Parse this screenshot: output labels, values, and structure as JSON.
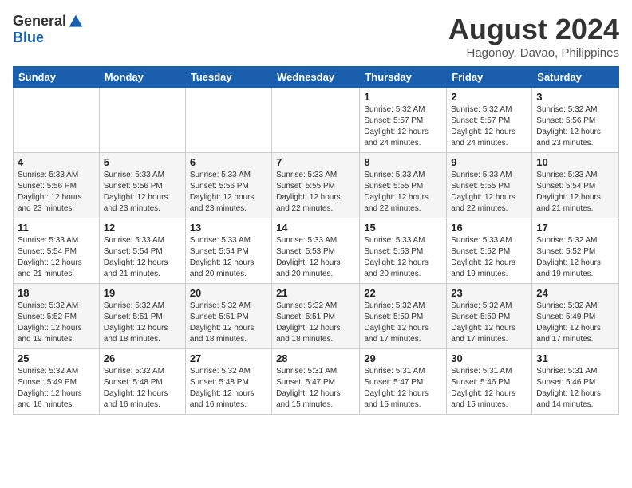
{
  "header": {
    "logo_general": "General",
    "logo_blue": "Blue",
    "month_year": "August 2024",
    "location": "Hagonoy, Davao, Philippines"
  },
  "days_of_week": [
    "Sunday",
    "Monday",
    "Tuesday",
    "Wednesday",
    "Thursday",
    "Friday",
    "Saturday"
  ],
  "weeks": [
    [
      {
        "day": "",
        "info": ""
      },
      {
        "day": "",
        "info": ""
      },
      {
        "day": "",
        "info": ""
      },
      {
        "day": "",
        "info": ""
      },
      {
        "day": "1",
        "info": "Sunrise: 5:32 AM\nSunset: 5:57 PM\nDaylight: 12 hours\nand 24 minutes."
      },
      {
        "day": "2",
        "info": "Sunrise: 5:32 AM\nSunset: 5:57 PM\nDaylight: 12 hours\nand 24 minutes."
      },
      {
        "day": "3",
        "info": "Sunrise: 5:32 AM\nSunset: 5:56 PM\nDaylight: 12 hours\nand 23 minutes."
      }
    ],
    [
      {
        "day": "4",
        "info": "Sunrise: 5:33 AM\nSunset: 5:56 PM\nDaylight: 12 hours\nand 23 minutes."
      },
      {
        "day": "5",
        "info": "Sunrise: 5:33 AM\nSunset: 5:56 PM\nDaylight: 12 hours\nand 23 minutes."
      },
      {
        "day": "6",
        "info": "Sunrise: 5:33 AM\nSunset: 5:56 PM\nDaylight: 12 hours\nand 23 minutes."
      },
      {
        "day": "7",
        "info": "Sunrise: 5:33 AM\nSunset: 5:55 PM\nDaylight: 12 hours\nand 22 minutes."
      },
      {
        "day": "8",
        "info": "Sunrise: 5:33 AM\nSunset: 5:55 PM\nDaylight: 12 hours\nand 22 minutes."
      },
      {
        "day": "9",
        "info": "Sunrise: 5:33 AM\nSunset: 5:55 PM\nDaylight: 12 hours\nand 22 minutes."
      },
      {
        "day": "10",
        "info": "Sunrise: 5:33 AM\nSunset: 5:54 PM\nDaylight: 12 hours\nand 21 minutes."
      }
    ],
    [
      {
        "day": "11",
        "info": "Sunrise: 5:33 AM\nSunset: 5:54 PM\nDaylight: 12 hours\nand 21 minutes."
      },
      {
        "day": "12",
        "info": "Sunrise: 5:33 AM\nSunset: 5:54 PM\nDaylight: 12 hours\nand 21 minutes."
      },
      {
        "day": "13",
        "info": "Sunrise: 5:33 AM\nSunset: 5:54 PM\nDaylight: 12 hours\nand 20 minutes."
      },
      {
        "day": "14",
        "info": "Sunrise: 5:33 AM\nSunset: 5:53 PM\nDaylight: 12 hours\nand 20 minutes."
      },
      {
        "day": "15",
        "info": "Sunrise: 5:33 AM\nSunset: 5:53 PM\nDaylight: 12 hours\nand 20 minutes."
      },
      {
        "day": "16",
        "info": "Sunrise: 5:33 AM\nSunset: 5:52 PM\nDaylight: 12 hours\nand 19 minutes."
      },
      {
        "day": "17",
        "info": "Sunrise: 5:32 AM\nSunset: 5:52 PM\nDaylight: 12 hours\nand 19 minutes."
      }
    ],
    [
      {
        "day": "18",
        "info": "Sunrise: 5:32 AM\nSunset: 5:52 PM\nDaylight: 12 hours\nand 19 minutes."
      },
      {
        "day": "19",
        "info": "Sunrise: 5:32 AM\nSunset: 5:51 PM\nDaylight: 12 hours\nand 18 minutes."
      },
      {
        "day": "20",
        "info": "Sunrise: 5:32 AM\nSunset: 5:51 PM\nDaylight: 12 hours\nand 18 minutes."
      },
      {
        "day": "21",
        "info": "Sunrise: 5:32 AM\nSunset: 5:51 PM\nDaylight: 12 hours\nand 18 minutes."
      },
      {
        "day": "22",
        "info": "Sunrise: 5:32 AM\nSunset: 5:50 PM\nDaylight: 12 hours\nand 17 minutes."
      },
      {
        "day": "23",
        "info": "Sunrise: 5:32 AM\nSunset: 5:50 PM\nDaylight: 12 hours\nand 17 minutes."
      },
      {
        "day": "24",
        "info": "Sunrise: 5:32 AM\nSunset: 5:49 PM\nDaylight: 12 hours\nand 17 minutes."
      }
    ],
    [
      {
        "day": "25",
        "info": "Sunrise: 5:32 AM\nSunset: 5:49 PM\nDaylight: 12 hours\nand 16 minutes."
      },
      {
        "day": "26",
        "info": "Sunrise: 5:32 AM\nSunset: 5:48 PM\nDaylight: 12 hours\nand 16 minutes."
      },
      {
        "day": "27",
        "info": "Sunrise: 5:32 AM\nSunset: 5:48 PM\nDaylight: 12 hours\nand 16 minutes."
      },
      {
        "day": "28",
        "info": "Sunrise: 5:31 AM\nSunset: 5:47 PM\nDaylight: 12 hours\nand 15 minutes."
      },
      {
        "day": "29",
        "info": "Sunrise: 5:31 AM\nSunset: 5:47 PM\nDaylight: 12 hours\nand 15 minutes."
      },
      {
        "day": "30",
        "info": "Sunrise: 5:31 AM\nSunset: 5:46 PM\nDaylight: 12 hours\nand 15 minutes."
      },
      {
        "day": "31",
        "info": "Sunrise: 5:31 AM\nSunset: 5:46 PM\nDaylight: 12 hours\nand 14 minutes."
      }
    ]
  ]
}
